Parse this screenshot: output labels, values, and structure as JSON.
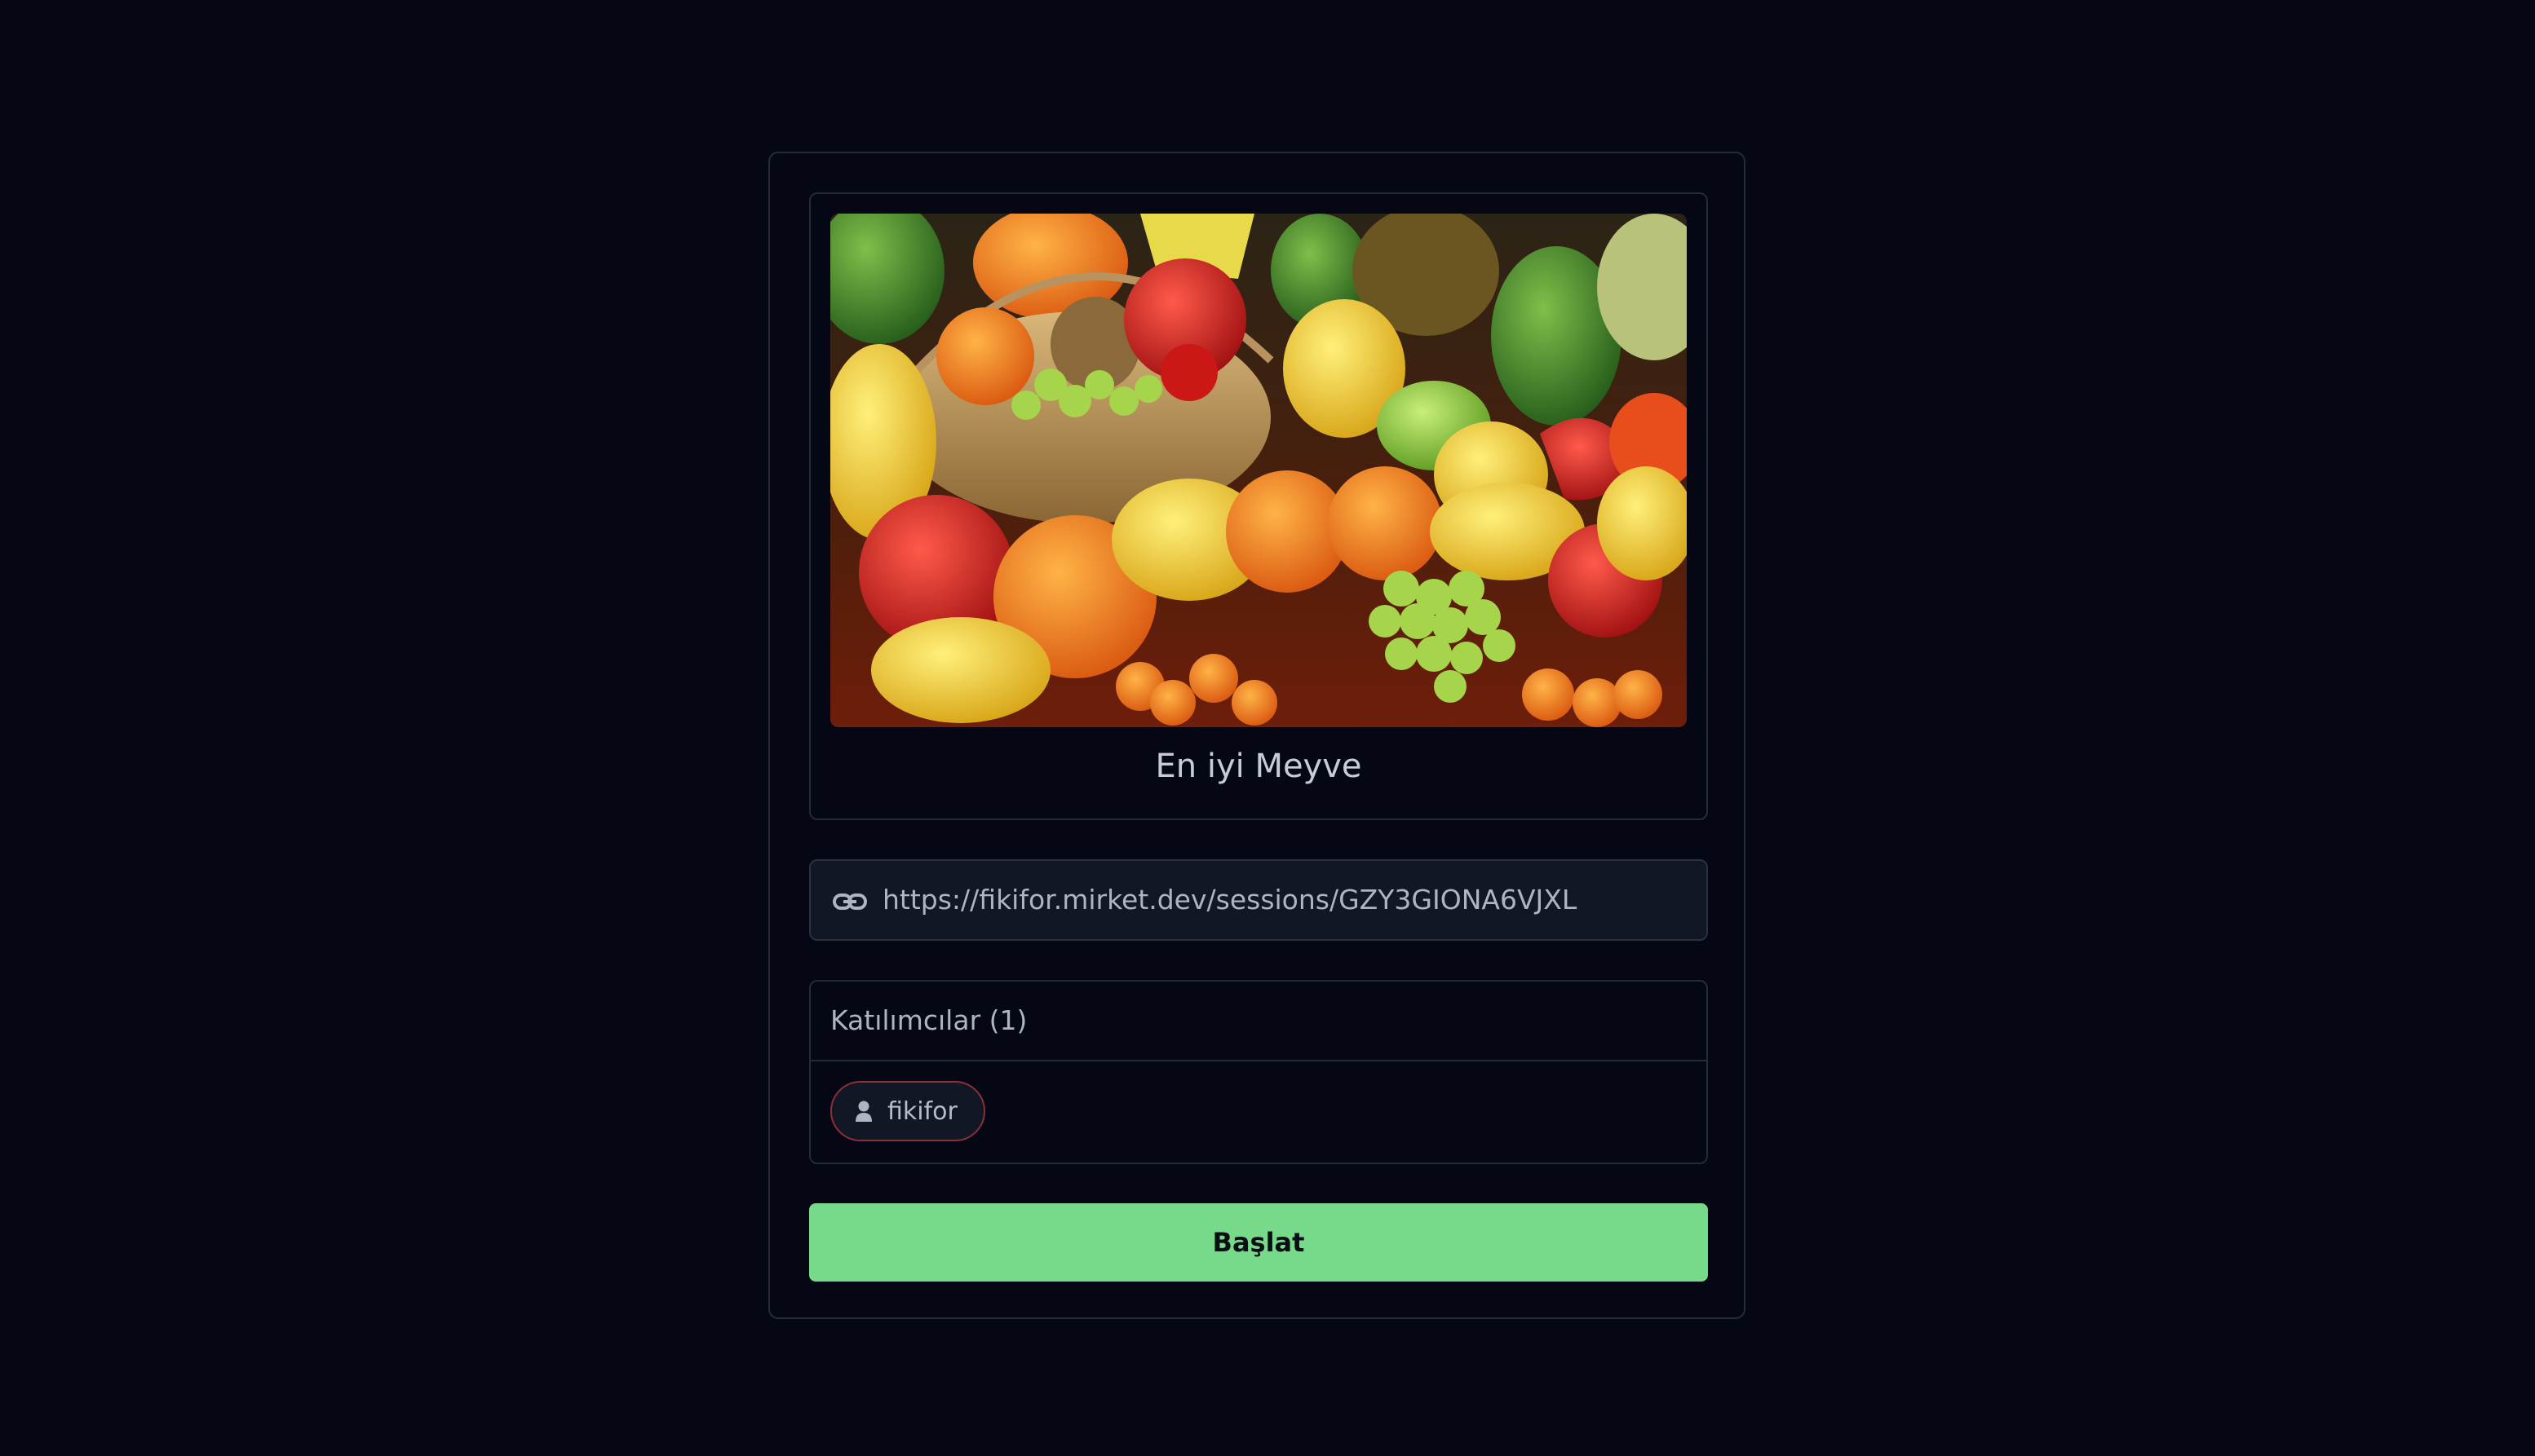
{
  "session": {
    "title": "En iyi Meyve",
    "image_alt": "fruit-basket-photo",
    "share_url": "https://fikifor.mirket.dev/sessions/GZY3GIONA6VJXL",
    "link_icon": "link-icon"
  },
  "participants": {
    "header": "Katılımcılar (1)",
    "list": [
      {
        "name": "fikifor",
        "icon": "user-icon",
        "accent": "#8c2f36"
      }
    ]
  },
  "actions": {
    "start_label": "Başlat",
    "start_color": "#77d98a"
  },
  "theme": {
    "background": "#050814",
    "border": "#262b38"
  }
}
